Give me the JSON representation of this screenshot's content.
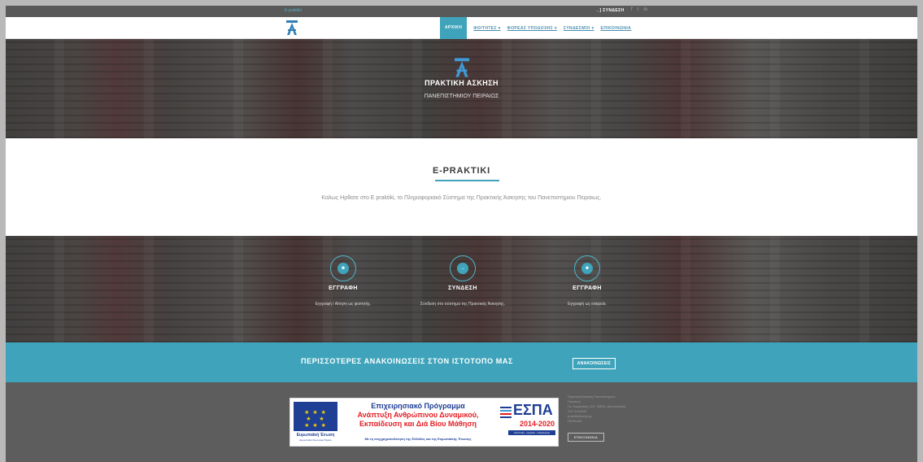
{
  "topbar": {
    "email": "E-praktiki",
    "login": "→] ΣΥΝΔΕΣΗ",
    "social": [
      "f",
      "t",
      "in"
    ]
  },
  "nav": {
    "items": [
      {
        "label": "ΑΡΧΙΚΗ",
        "active": true
      },
      {
        "label": "ΦΟΙΤΗΤΕΣ ▾"
      },
      {
        "label": "ΦΟΡΕΑΣ ΥΠΟΔΟΧΗΣ ▾"
      },
      {
        "label": "ΣΥΝΔΕΣΜΟΙ ▾"
      },
      {
        "label": "ΕΠΙΚΟΙΝΩΝΙΑ"
      }
    ]
  },
  "hero": {
    "title": "ΠΡΑΚΤΙΚΗ ΑΣΚΗΣΗ",
    "subtitle": "ΠΑΝΕΠΙΣΤΗΜΙΟΥ ΠΕΙΡΑΙΩΣ"
  },
  "intro": {
    "heading": "E-PRAKTIKI",
    "text": "Καλως Ηρθατε στο E praktiki, το Πληροφοριακό Σύστημα της Πρακτικής Άσκησης του Πανεπιστημιου Πειραιως."
  },
  "features": [
    {
      "icon": "user-icon",
      "glyph": "☻",
      "title": "ΕΓΓΡΑΦΗ",
      "desc": "Εγγραφή / Αίτηση ως φοιτητής."
    },
    {
      "icon": "login-icon",
      "glyph": "→",
      "title": "ΣΥΝΔΕΣΗ",
      "desc": "Σύνδεση στο σύστημα της Πρακτικής Άσκησης."
    },
    {
      "icon": "user-icon",
      "glyph": "☻",
      "title": "ΕΓΓΡΑΦΗ",
      "desc": "Εγγραφή ως εταιρεία."
    }
  ],
  "announce": {
    "text": "ΠΕΡΙΣΣΟΤΕΡΕΣ ΑΝΑΚΟΙΝΩΣΕΙΣ ΣΤΟΝ ΙΣΤΟΤΟΠΟ ΜΑΣ",
    "button": "ΑΝΑΚΟΙΝΩΣΕΙΣ"
  },
  "espa": {
    "eu_label": "Ευρωπαϊκή Ένωση",
    "eu_sub": "Ευρωπαϊκό Κοινωνικό Ταμείο",
    "line1": "Επιχειρησιακό Πρόγραμμα",
    "line2": "Ανάπτυξη Ανθρώπινου Δυναμικού,",
    "line3": "Εκπαίδευση και Διά Βίου Μάθηση",
    "cofund": "Με τη συγχρηματοδότηση της Ελλάδας και της Ευρωπαϊκής Ένωσης",
    "word": "ΕΣΠΑ",
    "years": "2014-2020",
    "tagline": "ανάπτυξη - εργασία - αλληλεγγύη"
  },
  "contact": {
    "lines": [
      "Πρακτική Άσκηση Πανεπιστημίου",
      "Πειραιώς",
      "Γρ. Λαμπράκη 122, 18535, Ακτή Δηλαδή",
      "210 4142040",
      "praktiki@unipi.gr",
      "ΠΕΙΡΑΙΑΣ"
    ],
    "button": "ΕΠΙΚΟΙΝΩΝΙΑ"
  },
  "colors": {
    "accent": "#3fa4bb",
    "topbar": "#595959",
    "footer": "#5d5d5d",
    "eu_blue": "#1f3f95",
    "espa_red": "#e31e24"
  }
}
